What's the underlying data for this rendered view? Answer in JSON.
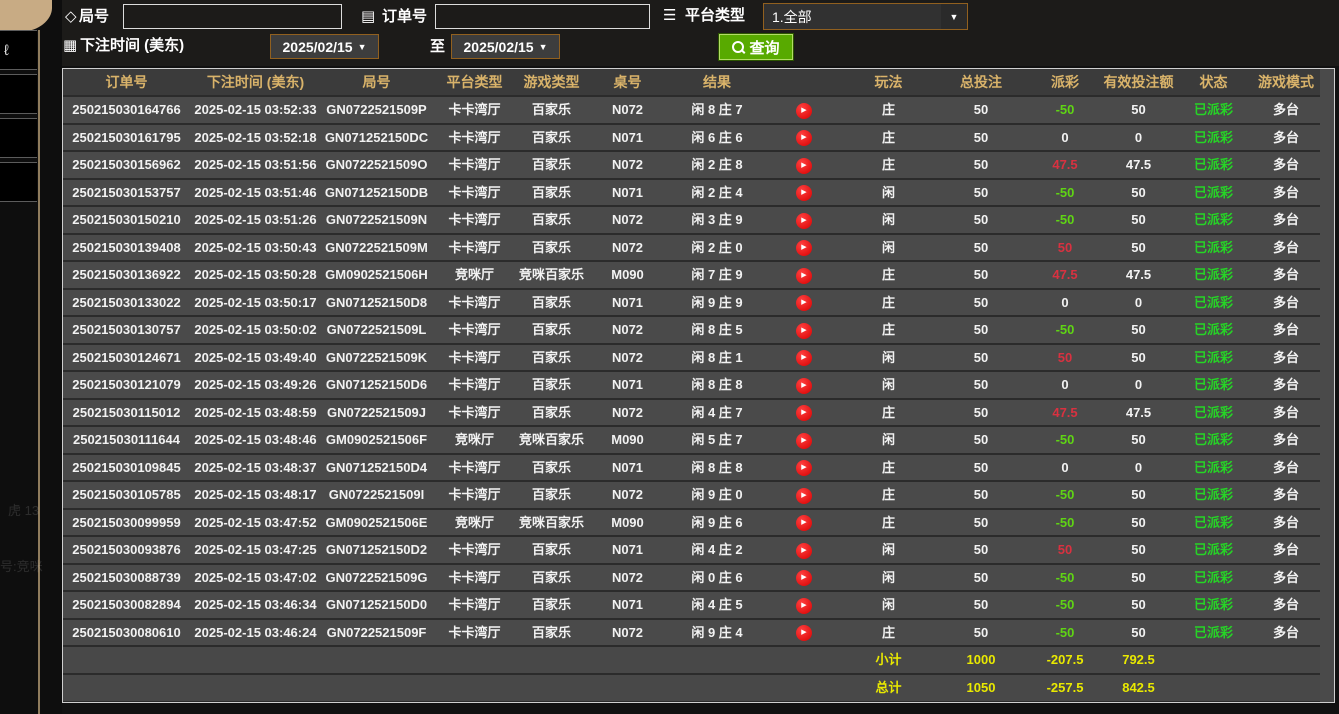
{
  "form": {
    "game_no_label": "局号",
    "order_no_label": "订单号",
    "platform_type_label": "平台类型",
    "platform_type_value": "1.全部",
    "bet_time_label": "下注时间 (美东)",
    "date_from": "2025/02/15",
    "date_to": "2025/02/15",
    "to_label": "至",
    "query_label": "查询",
    "tag_icon": "◇",
    "order_icon": "▤",
    "platform_icon": "☰",
    "calendar_icon": "▦",
    "dropdown_arrow": "▼"
  },
  "left_decor": {
    "ghost1": "虎 13",
    "ghost2": "号:竞咪",
    "glyph": "ℓ"
  },
  "table": {
    "headers": [
      "订单号",
      "下注时间 (美东)",
      "局号",
      "平台类型",
      "游戏类型",
      "桌号",
      "结果",
      "",
      "玩法",
      "总投注",
      "派彩",
      "有效投注额",
      "状态",
      "游戏模式"
    ],
    "play_glyph": "▶",
    "rows": [
      {
        "order": "250215030164766",
        "time": "2025-02-15 03:52:33",
        "round": "GN0722521509P",
        "hall": "卡卡湾厅",
        "game": "百家乐",
        "table": "N072",
        "result": "闲 8 庄 7",
        "play": "庄",
        "bet": "50",
        "payout": "-50",
        "payout_class": "neg",
        "valid": "50",
        "status": "已派彩",
        "mode": "多台"
      },
      {
        "order": "250215030161795",
        "time": "2025-02-15 03:52:18",
        "round": "GN071252150DC",
        "hall": "卡卡湾厅",
        "game": "百家乐",
        "table": "N071",
        "result": "闲 6 庄 6",
        "play": "庄",
        "bet": "50",
        "payout": "0",
        "payout_class": "zero",
        "valid": "0",
        "status": "已派彩",
        "mode": "多台"
      },
      {
        "order": "250215030156962",
        "time": "2025-02-15 03:51:56",
        "round": "GN0722521509O",
        "hall": "卡卡湾厅",
        "game": "百家乐",
        "table": "N072",
        "result": "闲 2 庄 8",
        "play": "庄",
        "bet": "50",
        "payout": "47.5",
        "payout_class": "pos",
        "valid": "47.5",
        "status": "已派彩",
        "mode": "多台"
      },
      {
        "order": "250215030153757",
        "time": "2025-02-15 03:51:46",
        "round": "GN071252150DB",
        "hall": "卡卡湾厅",
        "game": "百家乐",
        "table": "N071",
        "result": "闲 2 庄 4",
        "play": "闲",
        "bet": "50",
        "payout": "-50",
        "payout_class": "neg",
        "valid": "50",
        "status": "已派彩",
        "mode": "多台"
      },
      {
        "order": "250215030150210",
        "time": "2025-02-15 03:51:26",
        "round": "GN0722521509N",
        "hall": "卡卡湾厅",
        "game": "百家乐",
        "table": "N072",
        "result": "闲 3 庄 9",
        "play": "闲",
        "bet": "50",
        "payout": "-50",
        "payout_class": "neg",
        "valid": "50",
        "status": "已派彩",
        "mode": "多台"
      },
      {
        "order": "250215030139408",
        "time": "2025-02-15 03:50:43",
        "round": "GN0722521509M",
        "hall": "卡卡湾厅",
        "game": "百家乐",
        "table": "N072",
        "result": "闲 2 庄 0",
        "play": "闲",
        "bet": "50",
        "payout": "50",
        "payout_class": "pos",
        "valid": "50",
        "status": "已派彩",
        "mode": "多台"
      },
      {
        "order": "250215030136922",
        "time": "2025-02-15 03:50:28",
        "round": "GM0902521506H",
        "hall": "竞咪厅",
        "game": "竞咪百家乐",
        "table": "M090",
        "result": "闲 7 庄 9",
        "play": "庄",
        "bet": "50",
        "payout": "47.5",
        "payout_class": "pos",
        "valid": "47.5",
        "status": "已派彩",
        "mode": "多台"
      },
      {
        "order": "250215030133022",
        "time": "2025-02-15 03:50:17",
        "round": "GN071252150D8",
        "hall": "卡卡湾厅",
        "game": "百家乐",
        "table": "N071",
        "result": "闲 9 庄 9",
        "play": "庄",
        "bet": "50",
        "payout": "0",
        "payout_class": "zero",
        "valid": "0",
        "status": "已派彩",
        "mode": "多台"
      },
      {
        "order": "250215030130757",
        "time": "2025-02-15 03:50:02",
        "round": "GN0722521509L",
        "hall": "卡卡湾厅",
        "game": "百家乐",
        "table": "N072",
        "result": "闲 8 庄 5",
        "play": "庄",
        "bet": "50",
        "payout": "-50",
        "payout_class": "neg",
        "valid": "50",
        "status": "已派彩",
        "mode": "多台"
      },
      {
        "order": "250215030124671",
        "time": "2025-02-15 03:49:40",
        "round": "GN0722521509K",
        "hall": "卡卡湾厅",
        "game": "百家乐",
        "table": "N072",
        "result": "闲 8 庄 1",
        "play": "闲",
        "bet": "50",
        "payout": "50",
        "payout_class": "pos",
        "valid": "50",
        "status": "已派彩",
        "mode": "多台"
      },
      {
        "order": "250215030121079",
        "time": "2025-02-15 03:49:26",
        "round": "GN071252150D6",
        "hall": "卡卡湾厅",
        "game": "百家乐",
        "table": "N071",
        "result": "闲 8 庄 8",
        "play": "闲",
        "bet": "50",
        "payout": "0",
        "payout_class": "zero",
        "valid": "0",
        "status": "已派彩",
        "mode": "多台"
      },
      {
        "order": "250215030115012",
        "time": "2025-02-15 03:48:59",
        "round": "GN0722521509J",
        "hall": "卡卡湾厅",
        "game": "百家乐",
        "table": "N072",
        "result": "闲 4 庄 7",
        "play": "庄",
        "bet": "50",
        "payout": "47.5",
        "payout_class": "pos",
        "valid": "47.5",
        "status": "已派彩",
        "mode": "多台"
      },
      {
        "order": "250215030111644",
        "time": "2025-02-15 03:48:46",
        "round": "GM0902521506F",
        "hall": "竞咪厅",
        "game": "竞咪百家乐",
        "table": "M090",
        "result": "闲 5 庄 7",
        "play": "闲",
        "bet": "50",
        "payout": "-50",
        "payout_class": "neg",
        "valid": "50",
        "status": "已派彩",
        "mode": "多台"
      },
      {
        "order": "250215030109845",
        "time": "2025-02-15 03:48:37",
        "round": "GN071252150D4",
        "hall": "卡卡湾厅",
        "game": "百家乐",
        "table": "N071",
        "result": "闲 8 庄 8",
        "play": "庄",
        "bet": "50",
        "payout": "0",
        "payout_class": "zero",
        "valid": "0",
        "status": "已派彩",
        "mode": "多台"
      },
      {
        "order": "250215030105785",
        "time": "2025-02-15 03:48:17",
        "round": "GN0722521509I",
        "hall": "卡卡湾厅",
        "game": "百家乐",
        "table": "N072",
        "result": "闲 9 庄 0",
        "play": "庄",
        "bet": "50",
        "payout": "-50",
        "payout_class": "neg",
        "valid": "50",
        "status": "已派彩",
        "mode": "多台"
      },
      {
        "order": "250215030099959",
        "time": "2025-02-15 03:47:52",
        "round": "GM0902521506E",
        "hall": "竞咪厅",
        "game": "竞咪百家乐",
        "table": "M090",
        "result": "闲 9 庄 6",
        "play": "庄",
        "bet": "50",
        "payout": "-50",
        "payout_class": "neg",
        "valid": "50",
        "status": "已派彩",
        "mode": "多台"
      },
      {
        "order": "250215030093876",
        "time": "2025-02-15 03:47:25",
        "round": "GN071252150D2",
        "hall": "卡卡湾厅",
        "game": "百家乐",
        "table": "N071",
        "result": "闲 4 庄 2",
        "play": "闲",
        "bet": "50",
        "payout": "50",
        "payout_class": "pos",
        "valid": "50",
        "status": "已派彩",
        "mode": "多台"
      },
      {
        "order": "250215030088739",
        "time": "2025-02-15 03:47:02",
        "round": "GN0722521509G",
        "hall": "卡卡湾厅",
        "game": "百家乐",
        "table": "N072",
        "result": "闲 0 庄 6",
        "play": "闲",
        "bet": "50",
        "payout": "-50",
        "payout_class": "neg",
        "valid": "50",
        "status": "已派彩",
        "mode": "多台"
      },
      {
        "order": "250215030082894",
        "time": "2025-02-15 03:46:34",
        "round": "GN071252150D0",
        "hall": "卡卡湾厅",
        "game": "百家乐",
        "table": "N071",
        "result": "闲 4 庄 5",
        "play": "闲",
        "bet": "50",
        "payout": "-50",
        "payout_class": "neg",
        "valid": "50",
        "status": "已派彩",
        "mode": "多台"
      },
      {
        "order": "250215030080610",
        "time": "2025-02-15 03:46:24",
        "round": "GN0722521509F",
        "hall": "卡卡湾厅",
        "game": "百家乐",
        "table": "N072",
        "result": "闲 9 庄 4",
        "play": "庄",
        "bet": "50",
        "payout": "-50",
        "payout_class": "neg",
        "valid": "50",
        "status": "已派彩",
        "mode": "多台"
      }
    ],
    "subtotal": {
      "label": "小计",
      "bet": "1000",
      "payout": "-207.5",
      "valid": "792.5"
    },
    "total": {
      "label": "总计",
      "bet": "1050",
      "payout": "-257.5",
      "valid": "842.5"
    }
  },
  "colors": {
    "win_red": "#d93140",
    "loss_green": "#5fd414",
    "status_green": "#26d426",
    "footer_yellow": "#e9e900",
    "header_gold": "#d9b36a",
    "accent_border": "#91601f",
    "query_green": "#58aa00"
  }
}
